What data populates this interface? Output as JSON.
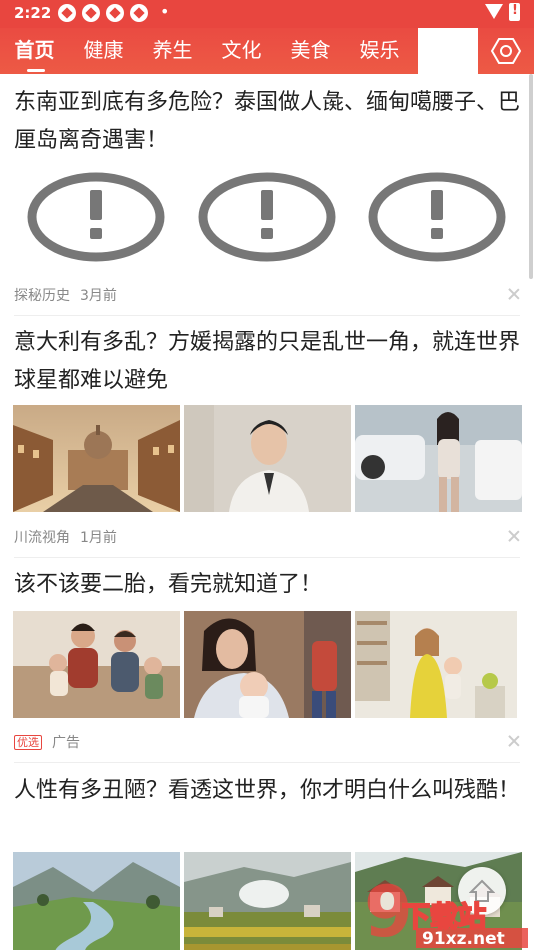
{
  "status_bar": {
    "time": "2:22",
    "dot": "•"
  },
  "tabs": [
    {
      "label": "首页"
    },
    {
      "label": "健康"
    },
    {
      "label": "养生"
    },
    {
      "label": "文化"
    },
    {
      "label": "美食"
    },
    {
      "label": "娱乐"
    }
  ],
  "articles": [
    {
      "title": "东南亚到底有多危险？泰国做人彘、缅甸噶腰子、巴厘岛离奇遇害！",
      "source": "探秘历史",
      "time": "3月前"
    },
    {
      "title": "意大利有多乱？方媛揭露的只是乱世一角，就连世界球星都难以避免",
      "source": "川流视角",
      "time": "1月前"
    },
    {
      "title": "该不该要二胎，看完就知道了！",
      "badge": "优选",
      "source": "广告"
    },
    {
      "title": "人性有多丑陋？看透这世界，你才明白什么叫残酷！"
    }
  ],
  "watermark": {
    "text": "下载站",
    "domain": "91xz.net"
  },
  "colors": {
    "brand": "#e8463f",
    "tab_text": "#ffffff",
    "meta": "#888888"
  }
}
